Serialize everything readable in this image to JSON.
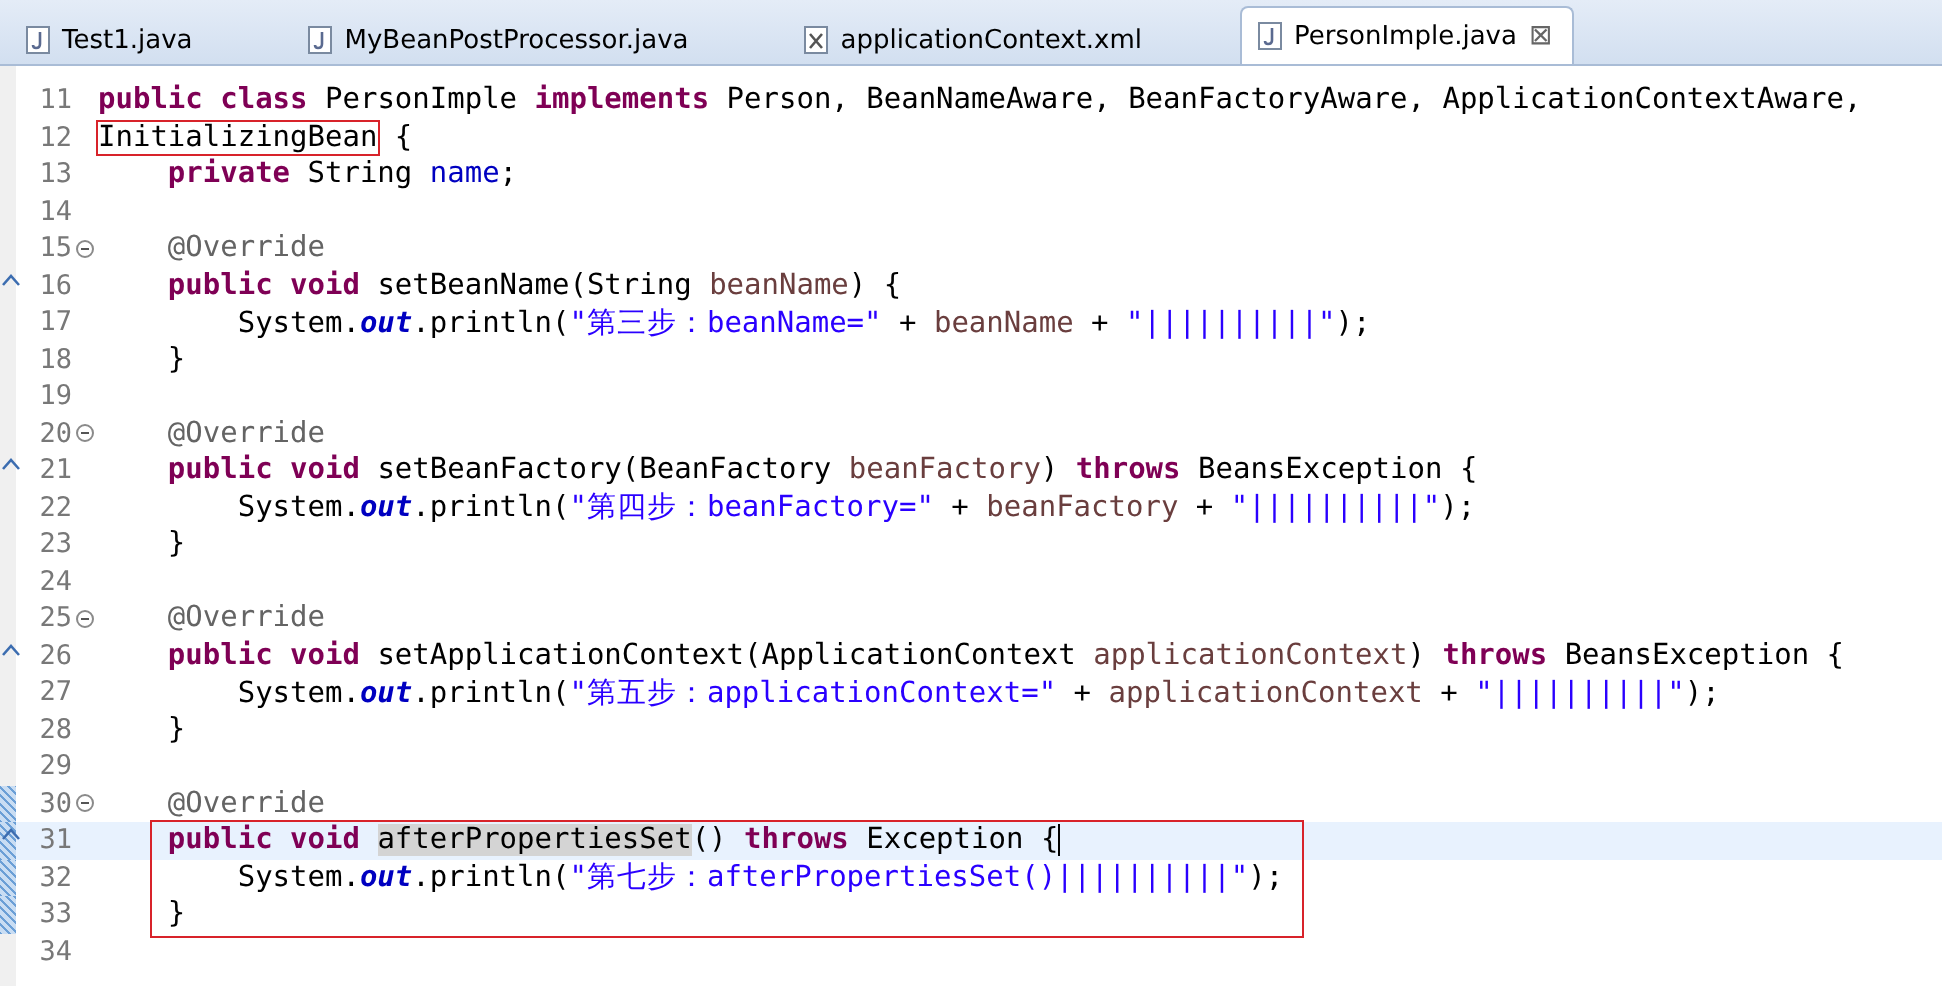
{
  "tabs": [
    {
      "label": "Test1.java",
      "kind": "java",
      "selected": false
    },
    {
      "label": "MyBeanPostProcessor.java",
      "kind": "java",
      "selected": false
    },
    {
      "label": "applicationContext.xml",
      "kind": "xml",
      "selected": false
    },
    {
      "label": "PersonImple.java",
      "kind": "java",
      "selected": true,
      "close": "⊠"
    }
  ],
  "editor": {
    "lines": [
      {
        "number": "11",
        "tokens": [
          {
            "kind": "kw",
            "text": "public class "
          },
          {
            "kind": "plain",
            "text": "PersonImple "
          },
          {
            "kind": "kw",
            "text": "implements "
          },
          {
            "kind": "plain",
            "text": "Person, BeanNameAware, BeanFactoryAware, ApplicationContextAware,"
          }
        ]
      },
      {
        "number": "12",
        "tokens": [
          {
            "kind": "plain",
            "text": "InitializingBean",
            "boxed": true
          },
          {
            "kind": "plain",
            "text": " {"
          }
        ]
      },
      {
        "number": "13",
        "tokens": [
          {
            "kind": "kw",
            "text": "    private "
          },
          {
            "kind": "plain",
            "text": "String "
          },
          {
            "kind": "field",
            "text": "name"
          },
          {
            "kind": "plain",
            "text": ";"
          }
        ]
      },
      {
        "number": "14"
      },
      {
        "number": "15",
        "kind": "fold",
        "tokens": [
          {
            "kind": "ann",
            "text": "    @Override"
          }
        ]
      },
      {
        "number": "16",
        "kind": "override",
        "tokens": [
          {
            "kind": "kw",
            "text": "    public void "
          },
          {
            "kind": "plain",
            "text": "setBeanName(String "
          },
          {
            "kind": "param",
            "text": "beanName"
          },
          {
            "kind": "plain",
            "text": ") {"
          }
        ]
      },
      {
        "number": "17",
        "tokens": [
          {
            "kind": "plain",
            "text": "        System."
          },
          {
            "kind": "static",
            "text": "out"
          },
          {
            "kind": "plain",
            "text": ".println("
          },
          {
            "kind": "str",
            "text": "\"第三步：beanName=\""
          },
          {
            "kind": "plain",
            "text": " + "
          },
          {
            "kind": "param",
            "text": "beanName"
          },
          {
            "kind": "plain",
            "text": " + "
          },
          {
            "kind": "str",
            "text": "\"||||||||||\""
          },
          {
            "kind": "plain",
            "text": ");"
          }
        ]
      },
      {
        "number": "18",
        "tokens": [
          {
            "kind": "plain",
            "text": "    }"
          }
        ]
      },
      {
        "number": "19"
      },
      {
        "number": "20",
        "kind": "fold",
        "tokens": [
          {
            "kind": "ann",
            "text": "    @Override"
          }
        ]
      },
      {
        "number": "21",
        "kind": "override",
        "tokens": [
          {
            "kind": "kw",
            "text": "    public void "
          },
          {
            "kind": "plain",
            "text": "setBeanFactory(BeanFactory "
          },
          {
            "kind": "param",
            "text": "beanFactory"
          },
          {
            "kind": "plain",
            "text": ") "
          },
          {
            "kind": "kw",
            "text": "throws "
          },
          {
            "kind": "plain",
            "text": "BeansException {"
          }
        ]
      },
      {
        "number": "22",
        "tokens": [
          {
            "kind": "plain",
            "text": "        System."
          },
          {
            "kind": "static",
            "text": "out"
          },
          {
            "kind": "plain",
            "text": ".println("
          },
          {
            "kind": "str",
            "text": "\"第四步：beanFactory=\""
          },
          {
            "kind": "plain",
            "text": " + "
          },
          {
            "kind": "param",
            "text": "beanFactory"
          },
          {
            "kind": "plain",
            "text": " + "
          },
          {
            "kind": "str",
            "text": "\"||||||||||\""
          },
          {
            "kind": "plain",
            "text": ");"
          }
        ]
      },
      {
        "number": "23",
        "tokens": [
          {
            "kind": "plain",
            "text": "    }"
          }
        ]
      },
      {
        "number": "24"
      },
      {
        "number": "25",
        "kind": "fold",
        "tokens": [
          {
            "kind": "ann",
            "text": "    @Override"
          }
        ]
      },
      {
        "number": "26",
        "kind": "override",
        "tokens": [
          {
            "kind": "kw",
            "text": "    public void "
          },
          {
            "kind": "plain",
            "text": "setApplicationContext(ApplicationContext "
          },
          {
            "kind": "param",
            "text": "applicationContext"
          },
          {
            "kind": "plain",
            "text": ") "
          },
          {
            "kind": "kw",
            "text": "throws "
          },
          {
            "kind": "plain",
            "text": "BeansException {"
          }
        ]
      },
      {
        "number": "27",
        "tokens": [
          {
            "kind": "plain",
            "text": "        System."
          },
          {
            "kind": "static",
            "text": "out"
          },
          {
            "kind": "plain",
            "text": ".println("
          },
          {
            "kind": "str",
            "text": "\"第五步：applicationContext=\""
          },
          {
            "kind": "plain",
            "text": " + "
          },
          {
            "kind": "param",
            "text": "applicationContext"
          },
          {
            "kind": "plain",
            "text": " + "
          },
          {
            "kind": "str",
            "text": "\"||||||||||\""
          },
          {
            "kind": "plain",
            "text": ");"
          }
        ]
      },
      {
        "number": "28",
        "tokens": [
          {
            "kind": "plain",
            "text": "    }"
          }
        ]
      },
      {
        "number": "29"
      },
      {
        "number": "30",
        "kind": "fold",
        "changed": true,
        "tokens": [
          {
            "kind": "ann",
            "text": "    @Override"
          }
        ]
      },
      {
        "number": "31",
        "kind": "override",
        "changed": true,
        "in_frame": true,
        "current": true,
        "tokens": [
          {
            "kind": "kw",
            "text": "    public void "
          },
          {
            "kind": "plain",
            "text": "afterPropertiesSet",
            "marked": true
          },
          {
            "kind": "plain",
            "text": "() "
          },
          {
            "kind": "kw",
            "text": "throws "
          },
          {
            "kind": "plain",
            "text": "Exception {"
          }
        ]
      },
      {
        "number": "32",
        "changed": true,
        "in_frame": true,
        "tokens": [
          {
            "kind": "plain",
            "text": "        System."
          },
          {
            "kind": "static",
            "text": "out"
          },
          {
            "kind": "plain",
            "text": ".println("
          },
          {
            "kind": "str",
            "text": "\"第七步：afterPropertiesSet()||||||||||\""
          },
          {
            "kind": "plain",
            "text": ");"
          }
        ]
      },
      {
        "number": "33",
        "changed": true,
        "in_frame": true,
        "tokens": [
          {
            "kind": "plain",
            "text": "    }"
          }
        ]
      },
      {
        "number": "34"
      }
    ]
  }
}
